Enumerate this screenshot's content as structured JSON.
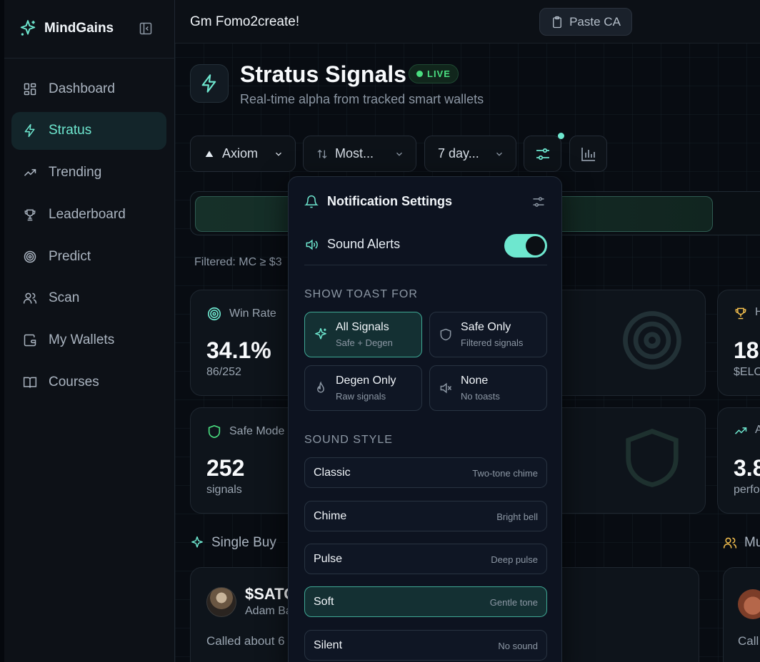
{
  "brand": {
    "name": "MindGains"
  },
  "sidebar": {
    "items": [
      {
        "label": "Dashboard",
        "icon": "dashboard-icon"
      },
      {
        "label": "Stratus",
        "icon": "bolt-icon",
        "active": true
      },
      {
        "label": "Trending",
        "icon": "trending-icon"
      },
      {
        "label": "Leaderboard",
        "icon": "trophy-icon"
      },
      {
        "label": "Predict",
        "icon": "target-icon"
      },
      {
        "label": "Scan",
        "icon": "users-icon"
      },
      {
        "label": "My Wallets",
        "icon": "wallet-icon"
      },
      {
        "label": "Courses",
        "icon": "book-icon"
      }
    ]
  },
  "topbar": {
    "greeting": "Gm Fomo2create!",
    "paste_label": "Paste CA"
  },
  "page": {
    "title": "Stratus Signals",
    "badge": "LIVE",
    "subtitle": "Real-time alpha from tracked smart wallets"
  },
  "filters": {
    "platform": "Axiom",
    "sort": "Most...",
    "range": "7 day..."
  },
  "filtered_text": "Filtered: MC ≥ $3",
  "stats": {
    "win_rate": {
      "label": "Win Rate",
      "value": "34.1%",
      "sub": "86/252"
    },
    "safe_mode": {
      "label": "Safe Mode",
      "value": "252",
      "sub": "signals"
    },
    "side_top": {
      "label": "H",
      "value": "18",
      "sub": "$ELO"
    },
    "side_bottom": {
      "label": "A",
      "value": "3.8",
      "sub": "perfo"
    }
  },
  "sections": {
    "single_buy": "Single Buy",
    "multi": "Mu"
  },
  "call": {
    "token": "$SATO",
    "caller": "Adam Ba",
    "called": "Called about 6",
    "called2": "Call"
  },
  "popover": {
    "title": "Notification Settings",
    "sound_alerts": "Sound Alerts",
    "sound_alerts_on": true,
    "toast_section": "SHOW TOAST FOR",
    "toast_options": [
      {
        "title": "All Signals",
        "desc": "Safe + Degen",
        "selected": true
      },
      {
        "title": "Safe Only",
        "desc": "Filtered signals",
        "selected": false
      },
      {
        "title": "Degen Only",
        "desc": "Raw signals",
        "selected": false
      },
      {
        "title": "None",
        "desc": "No toasts",
        "selected": false
      }
    ],
    "sound_section": "SOUND STYLE",
    "sound_options": [
      {
        "name": "Classic",
        "desc": "Two-tone chime",
        "selected": false
      },
      {
        "name": "Chime",
        "desc": "Bright bell",
        "selected": false
      },
      {
        "name": "Pulse",
        "desc": "Deep pulse",
        "selected": false
      },
      {
        "name": "Soft",
        "desc": "Gentle tone",
        "selected": true
      },
      {
        "name": "Silent",
        "desc": "No sound",
        "selected": false
      }
    ]
  },
  "colors": {
    "accent": "#6ee7cf",
    "live": "#4ade80",
    "gold": "#f5c04e"
  }
}
